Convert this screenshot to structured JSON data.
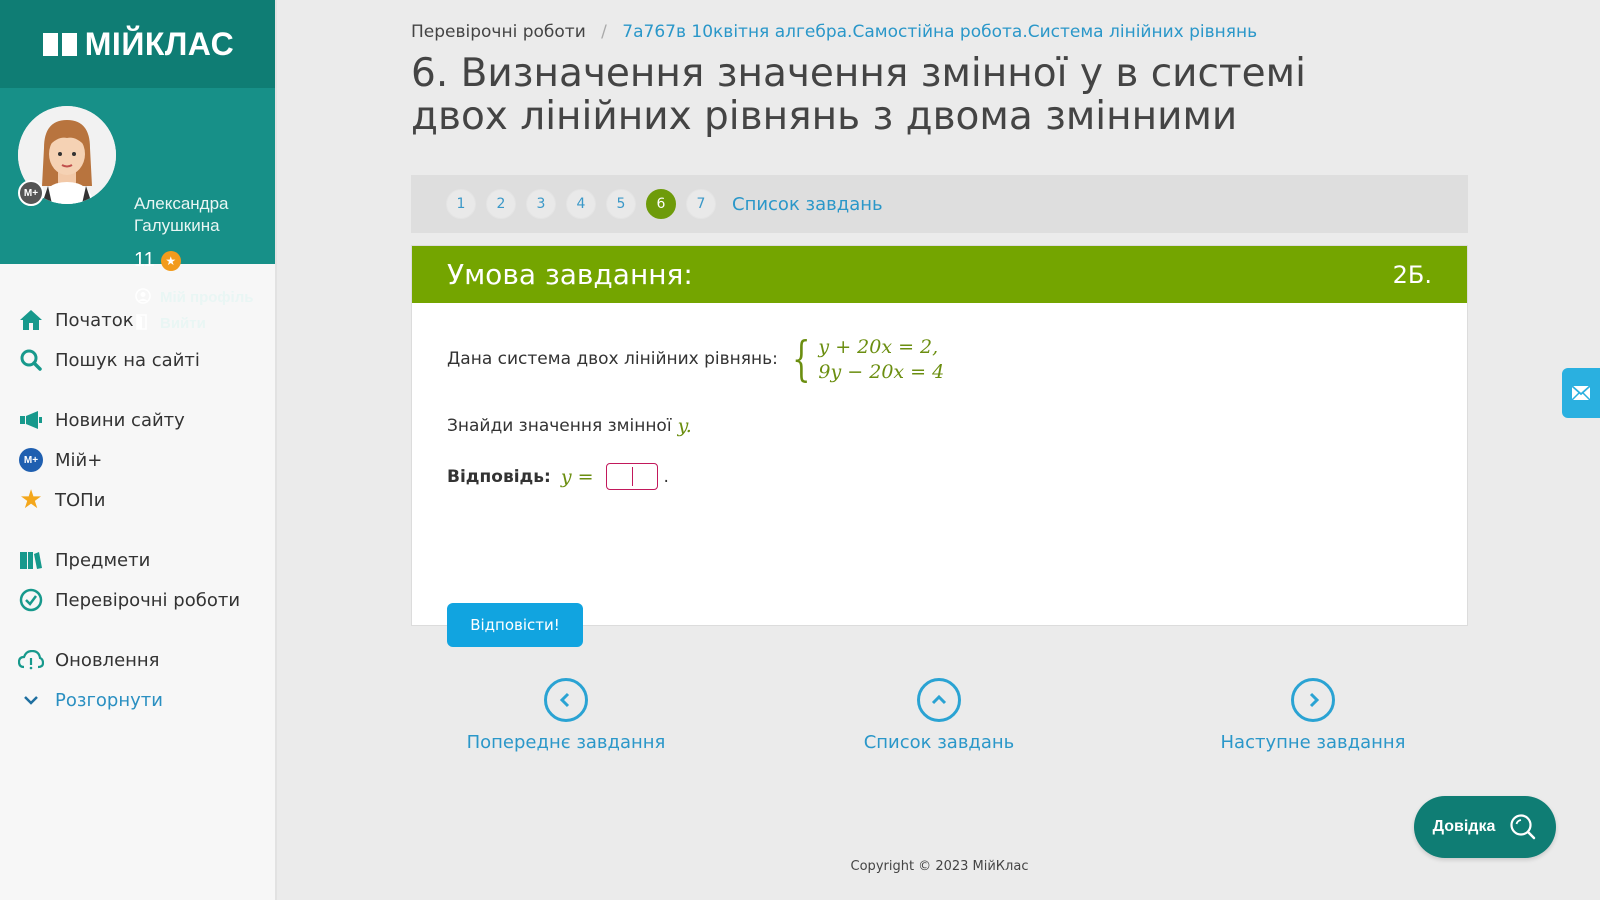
{
  "brand": {
    "logo_text": "МІЙКЛАС"
  },
  "profile": {
    "first_name": "Александра",
    "last_name": "Галушкина",
    "grade": "11",
    "avatar_badge": "M+",
    "my_profile": "Мій профіль",
    "logout": "Вийти"
  },
  "nav": {
    "home": "Початок",
    "search": "Пошук на сайті",
    "news": "Новини сайту",
    "myplus": "Мій+",
    "tops": "ТОПи",
    "subjects": "Предмети",
    "tests": "Перевірочні роботи",
    "updates": "Оновлення",
    "expand": "Розгорнути"
  },
  "breadcrumb": {
    "root": "Перевірочні роботи",
    "separator": "/",
    "current": "7а767в 10квітня алгебра.Самостійна робота.Система лінійних рівнянь"
  },
  "page_title": "6. Визначення значення змінної y в системі двох лінійних рівнянь з двома змінними",
  "task_nav": {
    "numbers": [
      "1",
      "2",
      "3",
      "4",
      "5",
      "6",
      "7"
    ],
    "active": "6",
    "list_link": "Список завдань"
  },
  "task": {
    "header": "Умова завдання:",
    "points": "2Б.",
    "intro": "Дана система двох лінійних рівнянь:",
    "eq1": "y + 20x = 2,",
    "eq2": "9y − 20x = 4",
    "question_prefix": "Знайди значення змінної",
    "question_var": "y.",
    "answer_label": "Відповідь:",
    "answer_lhs": "y =",
    "answer_value": "",
    "answer_suffix": ".",
    "submit": "Відповісти!"
  },
  "bottom_nav": {
    "prev": "Попереднє завдання",
    "list": "Список завдань",
    "next": "Наступне завдання"
  },
  "footer": {
    "copyright": "Copyright © 2023 МійКлас"
  },
  "help": {
    "label": "Довідка"
  },
  "colors": {
    "brand_dark": "#0f7d74",
    "brand": "#179088",
    "task_header": "#74a500",
    "link": "#2a97c9",
    "submit": "#11a4e0"
  }
}
